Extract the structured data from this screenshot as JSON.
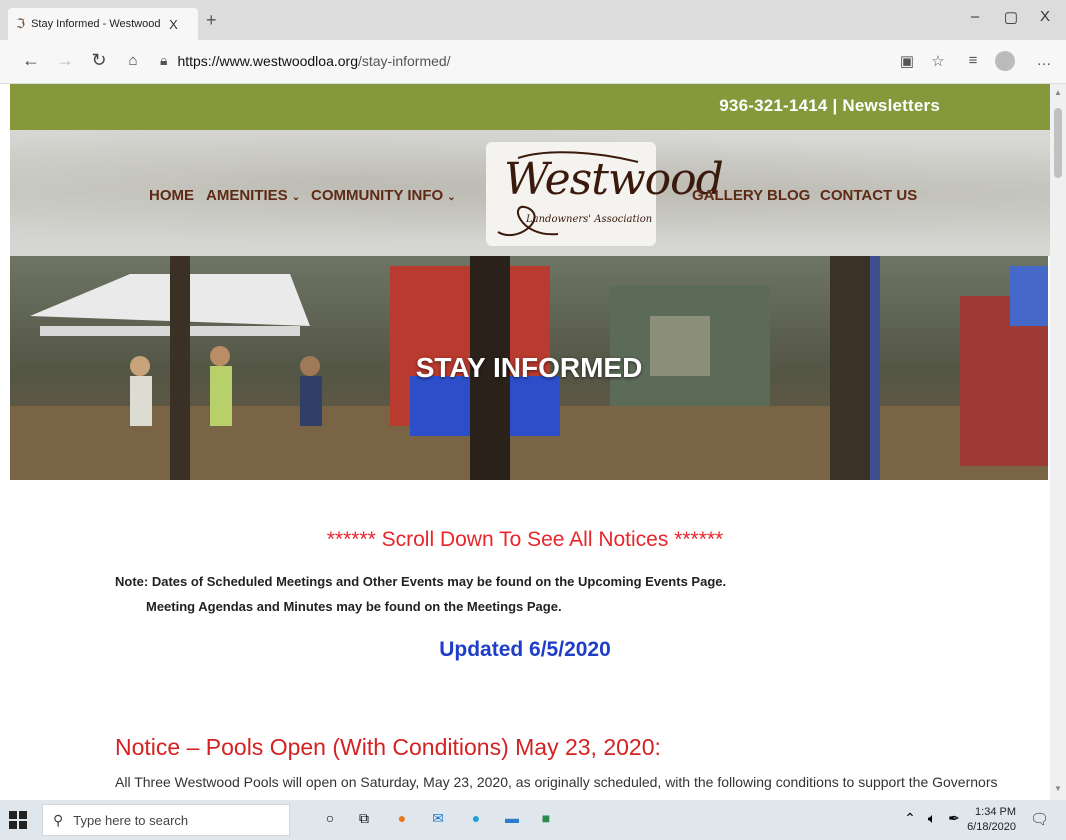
{
  "browser": {
    "tab_title": "Stay Informed - Westwood Land",
    "tab_close": "X",
    "new_tab": "+",
    "minimize": "–",
    "restore": "▢",
    "close": "X",
    "url_host": "https://www.westwoodloa.org",
    "url_path": "/stay-informed/",
    "more": "…"
  },
  "site": {
    "topbar_phone": "936-321-1414",
    "topbar_sep": " | ",
    "topbar_link": "Newsletters",
    "nav": {
      "home": "HOME",
      "amenities": "AMENITIES",
      "community": "COMMUNITY INFO",
      "gallery": "GALLERY",
      "blog": "BLOG",
      "contact": "CONTACT US"
    },
    "logo_name": "Westwood",
    "logo_sub": "Landowners' Association",
    "hero_title": "STAY INFORMED"
  },
  "content": {
    "scroll_note": "****** Scroll Down To See All Notices ******",
    "note1": "Note: Dates of Scheduled Meetings and Other Events may be found on the Upcoming Events Page.",
    "note2": "Meeting Agendas and Minutes may be found on the Meetings Page.",
    "updated": "Updated 6/5/2020",
    "notice_title": "Notice – Pools Open (With Conditions) May 23, 2020:",
    "notice_body": "All Three Westwood Pools will open on Saturday, May 23, 2020, as originally scheduled, with the following conditions to support the Governors"
  },
  "taskbar": {
    "search_placeholder": "Type here to search",
    "time": "1:34 PM",
    "date": "6/18/2020"
  },
  "colors": {
    "topbar": "#85993c",
    "nav_text": "#5e2a14",
    "scroll_note": "#e8262b",
    "updated": "#1f3ec7",
    "notice_title": "#d42222"
  }
}
